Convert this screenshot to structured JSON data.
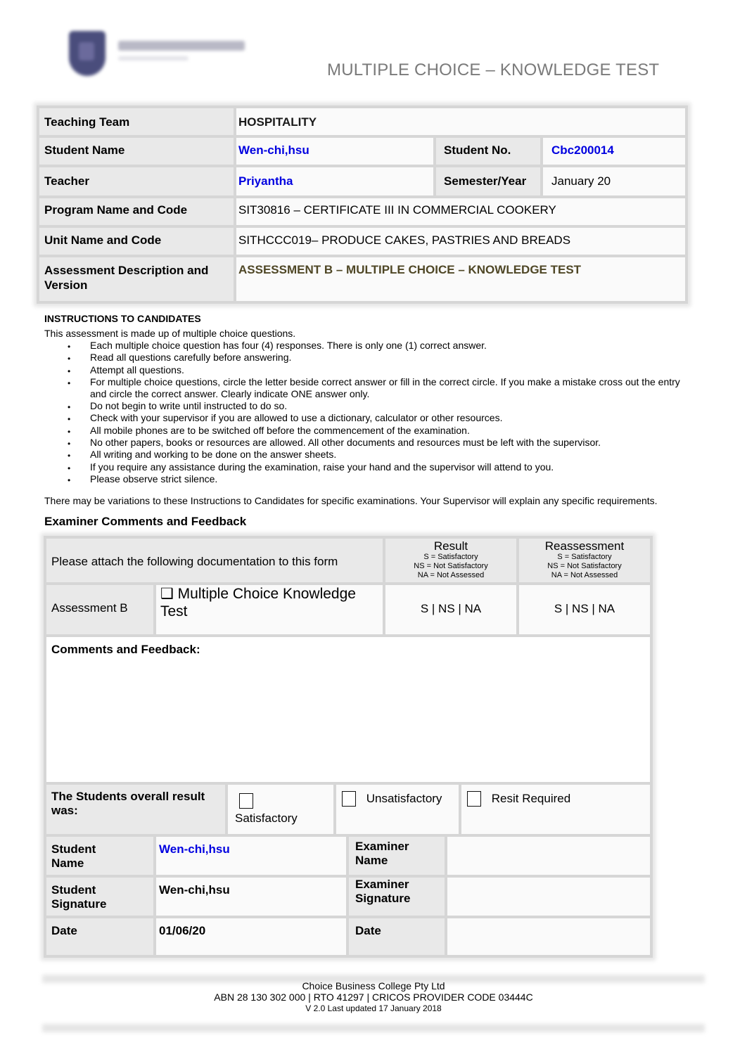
{
  "header": {
    "logo_icon": "college-shield-logo",
    "title": "MULTIPLE CHOICE – KNOWLEDGE TEST"
  },
  "info": {
    "teaching_team_label": "Teaching Team",
    "teaching_team_value": "HOSPITALITY",
    "student_name_label": "Student Name",
    "student_name_value": "Wen-chi,hsu",
    "student_no_label": "Student No.",
    "student_no_value": "Cbc200014",
    "teacher_label": "Teacher",
    "teacher_value": "Priyantha",
    "semester_label": "Semester/Year",
    "semester_value": "January 20",
    "program_label": "Program Name and Code",
    "program_value": "SIT30816 – CERTIFICATE III IN COMMERCIAL COOKERY",
    "unit_label": "Unit Name and Code",
    "unit_value": "SITHCCC019– PRODUCE CAKES, PASTRIES AND BREADS",
    "assessment_label": "Assessment Description and Version",
    "assessment_value": "ASSESSMENT B – MULTIPLE CHOICE – KNOWLEDGE TEST"
  },
  "instructions": {
    "heading": "INSTRUCTIONS TO CANDIDATES",
    "intro": "This assessment is made up of multiple choice questions.",
    "items": [
      "Each multiple choice question has four (4) responses. There is only one (1) correct answer.",
      "Read all questions carefully before answering.",
      "Attempt all questions.",
      "For multiple choice questions, circle the letter beside correct answer or fill in the correct circle. If you make a mistake cross out the entry and circle the correct answer. Clearly indicate ONE answer only.",
      "Do not begin to write until instructed to do so.",
      "Check with your supervisor if you are allowed to use a dictionary, calculator or other resources.",
      "All mobile phones are to be switched off before the commencement of the examination.",
      "No other papers, books or resources are allowed. All other documents and resources must be left with the supervisor.",
      "All writing and working to be done on the answer sheets.",
      "If you require any assistance during the examination, raise your hand and the supervisor will attend to you.",
      "Please observe strict silence."
    ],
    "note": "There may be variations to these Instructions to Candidates for specific examinations. Your Supervisor will explain any specific requirements."
  },
  "examiner": {
    "heading": "Examiner Comments and Feedback",
    "attach_text": "Please attach the following documentation to this form",
    "result_heading": "Result",
    "reassessment_heading": "Reassessment",
    "legend_s": "S = Satisfactory",
    "legend_ns": "NS = Not Satisfactory",
    "legend_na": "NA = Not Assessed",
    "assessment_label": "Assessment B",
    "assessment_item": "❑ Multiple Choice Knowledge Test",
    "result_options": "S   |   NS   |   NA",
    "reassessment_options": "S   |   NS   |   NA",
    "comments_label": "Comments and Feedback:",
    "comments_value": "",
    "overall_label": "The Students overall result was:",
    "opt_satisfactory": "Satisfactory",
    "opt_unsatisfactory": "Unsatisfactory",
    "opt_resit": "Resit Required",
    "student_name_label": "Student Name",
    "student_name_value": "Wen-chi,hsu",
    "examiner_name_label": "Examiner Name",
    "examiner_name_value": "",
    "student_sig_label": "Student Signature",
    "student_sig_value": "Wen-chi,hsu",
    "examiner_sig_label": "Examiner Signature",
    "examiner_sig_value": "",
    "date_label": "Date",
    "date_value": "01/06/20",
    "examiner_date_label": "Date",
    "examiner_date_value": ""
  },
  "footer": {
    "company": "Choice Business College Pty Ltd",
    "codes": "ABN 28 130 302 000 | RTO 41297 | CRICOS PROVIDER CODE 03444C",
    "version": "V 2.0 Last updated 17 January 2018"
  },
  "colors": {
    "filled_value_blue": "#0000e0",
    "assessment_olive": "#4f4726",
    "title_gray": "#7a7a7a"
  }
}
